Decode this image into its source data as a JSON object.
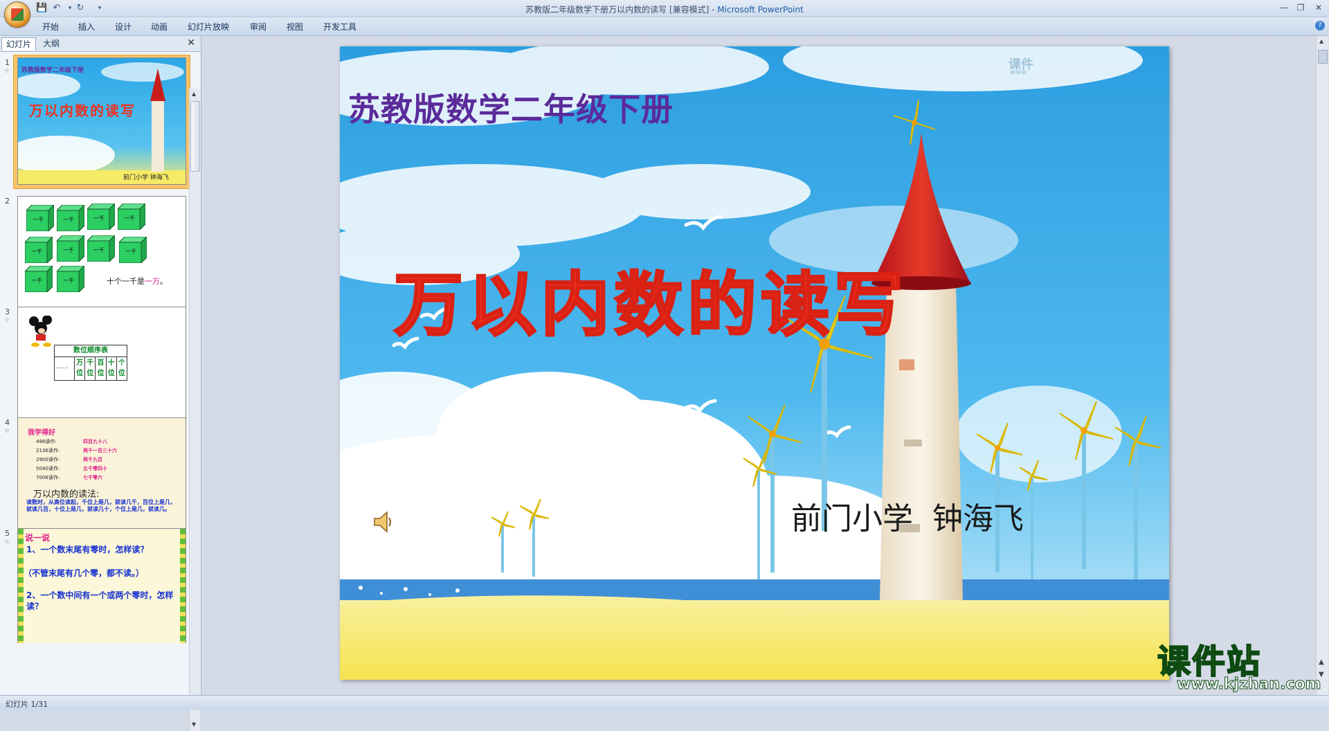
{
  "window": {
    "title": "苏教版二年级数学下册万以内数的读写 [兼容模式]",
    "app_name": "Microsoft PowerPoint",
    "separator": " - "
  },
  "ribbon": {
    "tabs": [
      "开始",
      "插入",
      "设计",
      "动画",
      "幻灯片放映",
      "审阅",
      "视图",
      "开发工具"
    ]
  },
  "panel": {
    "tab_slides": "幻灯片",
    "tab_outline": "大纲"
  },
  "thumbnails": {
    "numbers": [
      "1",
      "2",
      "3",
      "4",
      "5"
    ],
    "t1": {
      "subtitle": "苏教版数学二年级下册",
      "title": "万以内数的读写",
      "author": "前门小学  钟海飞"
    },
    "t2": {
      "cube_label": "一千",
      "caption_prefix": "十个一千是",
      "caption_highlight": "一万",
      "caption_suffix": "。"
    },
    "t3": {
      "table_title": "数位顺序表",
      "dots": "……",
      "cols": [
        "万位",
        "千位",
        "百位",
        "十位",
        "个位"
      ]
    },
    "t4": {
      "heading": "我学得好",
      "rows": [
        {
          "num": "498读作:",
          "val": "四百九十八"
        },
        {
          "num": "2136读作:",
          "val": "两千一百三十六"
        },
        {
          "num": "2900读作:",
          "val": "两千九百"
        },
        {
          "num": "5040读作:",
          "val": "五千零四十"
        },
        {
          "num": "7006读作:",
          "val": "七千零六"
        }
      ],
      "rule_title": "万以内数的读法:",
      "rule_text": "读数时，从高位读起，千位上是几，就读几千，百位上是几，就读几百，十位上是几，就读几十，个位上是几，就读几。"
    },
    "t5": {
      "heading": "说一说",
      "q1": "1、一个数末尾有零时，怎样读？",
      "a1": "（不管末尾有几个零，都不读。）",
      "q2": "2、一个数中间有一个或两个零时，怎样读？"
    }
  },
  "slide": {
    "subtitle": "苏教版数学二年级下册",
    "title": "万以内数的读写",
    "author": "前门小学  钟海飞",
    "corner_mark_top": "课件",
    "corner_mark_bottom": "www"
  },
  "status": {
    "text": "幻灯片 1/31"
  },
  "watermark": {
    "title": "课件站",
    "url": "www.kjzhan.com"
  }
}
